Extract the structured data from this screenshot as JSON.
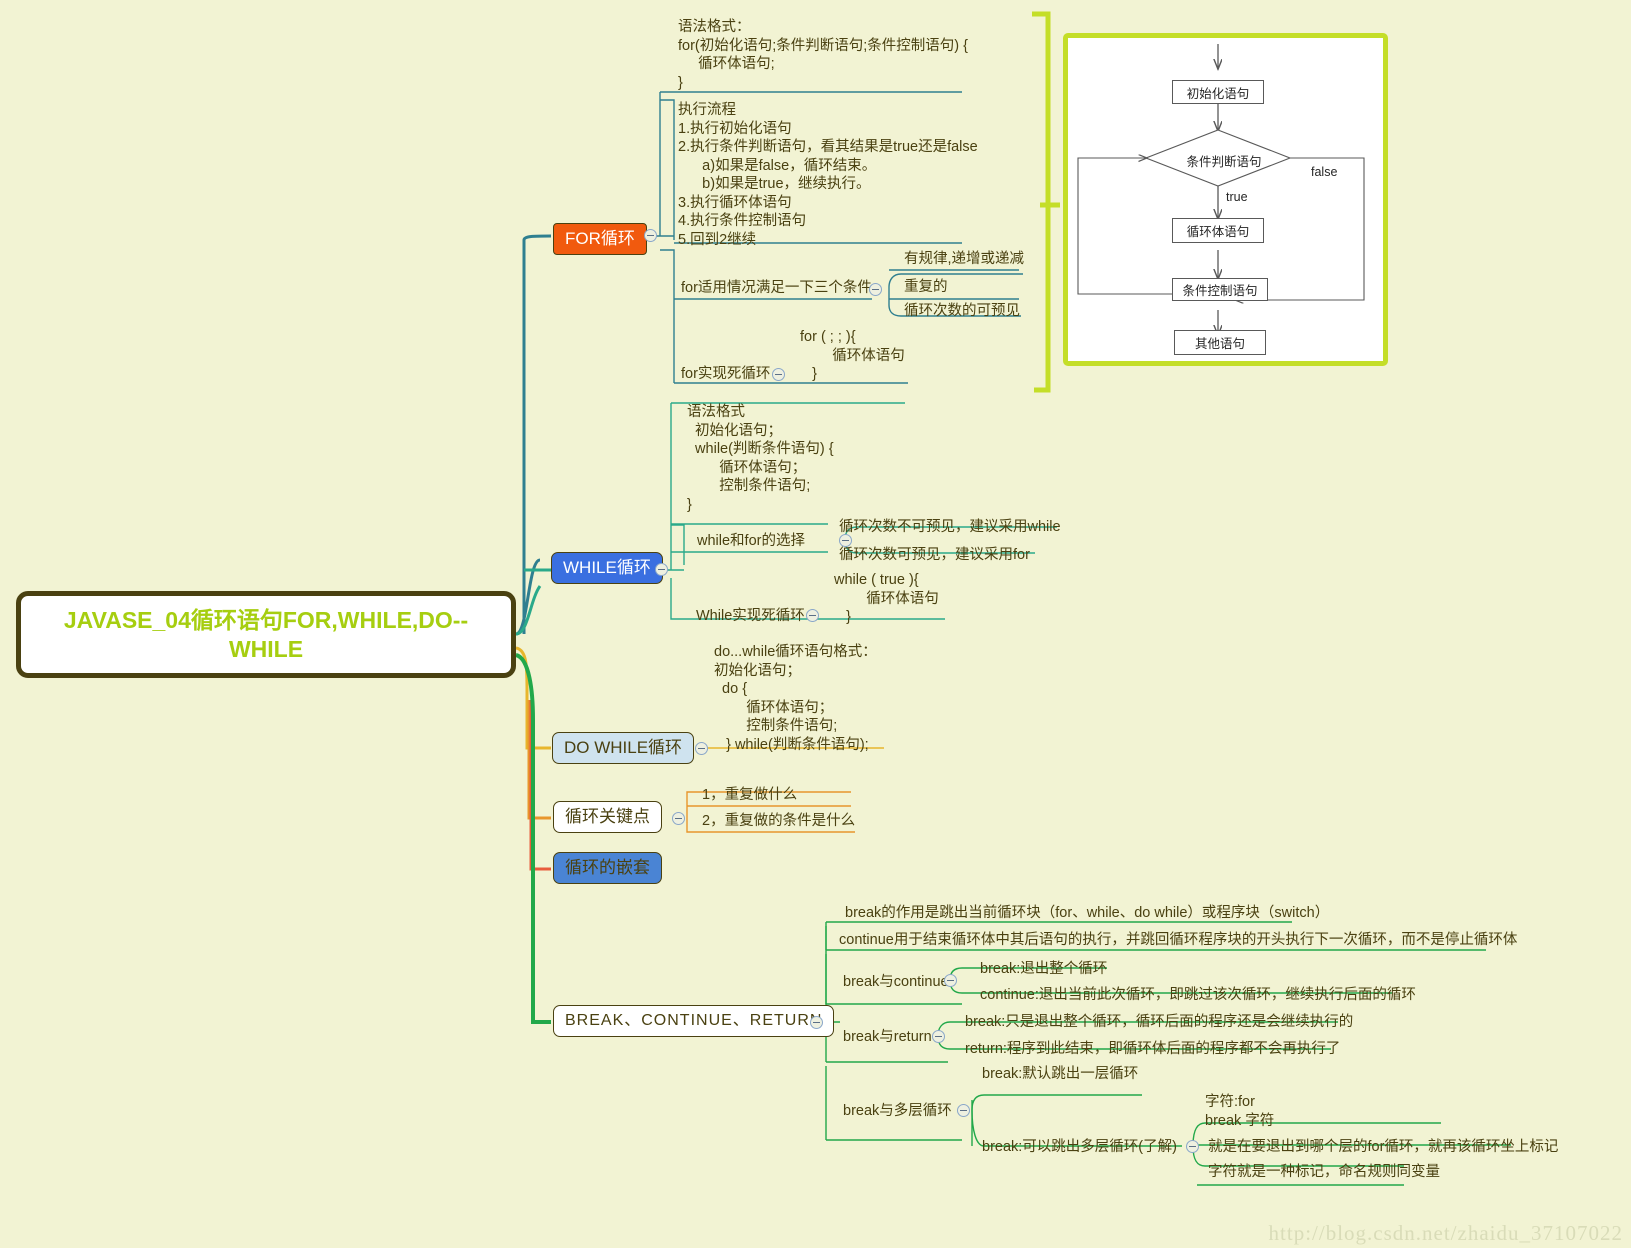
{
  "root": {
    "label": "JAVASE_04循环语句FOR,WHILE,DO--WHILE"
  },
  "topics": {
    "for": "FOR循环",
    "while": "WHILE循环",
    "dowhile": "DO WHILE循环",
    "keypoint": "循环关键点",
    "nest": "循环的嵌套",
    "bcr": "BREAK、CONTINUE、RETURN"
  },
  "for_branch": {
    "syntax": "语法格式：\nfor(初始化语句;条件判断语句;条件控制语句) {\n     循环体语句;\n}",
    "flow": "执行流程\n1.执行初始化语句\n2.执行条件判断语句，看其结果是true还是false\n      a)如果是false，循环结束。\n      b)如果是true，继续执行。\n3.执行循环体语句\n4.执行条件控制语句\n5.回到2继续",
    "conditions_label": "for适用情况满足一下三个条件",
    "conditions": [
      "有规律,递增或递减",
      "重复的",
      "循环次数的可预见"
    ],
    "dead_loop_label": "for实现死循环",
    "dead_loop_code": "for ( ; ; ){\n        循环体语句\n   }"
  },
  "flowchart": {
    "nodes": {
      "init": "初始化语句",
      "condition": "条件判断语句",
      "body": "循环体语句",
      "control": "条件控制语句",
      "other": "其他语句"
    },
    "labels": {
      "true": "true",
      "false": "false"
    }
  },
  "while_branch": {
    "syntax": "语法格式\n  初始化语句；\n  while(判断条件语句) {\n        循环体语句；\n        控制条件语句;\n}",
    "choice_label": "while和for的选择",
    "choices": [
      "循环次数不可预见，建议采用while",
      "循环次数可预见，建议采用for"
    ],
    "dead_loop_label": "While实现死循环",
    "dead_loop_code": "while ( true ){\n        循环体语句\n   }"
  },
  "dowhile_branch": {
    "syntax": "do...while循环语句格式：\n初始化语句；\n  do {\n        循环体语句；\n        控制条件语句;\n   } while(判断条件语句);"
  },
  "keypoint_branch": {
    "items": [
      "1，重复做什么",
      "2，重复做的条件是什么"
    ]
  },
  "bcr_branch": {
    "top_notes": [
      "break的作用是跳出当前循环块（for、while、do while）或程序块（switch）",
      "continue用于结束循环体中其后语句的执行，并跳回循环程序块的开头执行下一次循环，而不是停止循环体"
    ],
    "groups": [
      {
        "label": "break与continue",
        "items": [
          "break:退出整个循环",
          "continue:退出当前此次循环，即跳过该次循环，继续执行后面的循环"
        ]
      },
      {
        "label": "break与return",
        "items": [
          "break:只是退出整个循环，循环后面的程序还是会继续执行的",
          "return:程序到此结束，即循环体后面的程序都不会再执行了"
        ]
      },
      {
        "label": "break与多层循环",
        "items": [
          "break:默认跳出一层循环",
          "break:可以跳出多层循环(了解)"
        ],
        "detail_label": "break:可以跳出多层循环(了解)",
        "details_note": "字符:for\nbreak 字符",
        "details": [
          "就是在要退出到哪个层的for循环，就再该循环坐上标记",
          "字符就是一种标记，命名规则同变量"
        ]
      }
    ]
  },
  "watermark": "http://blog.csdn.net/zhaidu_37107022",
  "colors": {
    "background": "#f2f3d3",
    "root_border": "#4a4111",
    "root_text": "#a6ce10",
    "for_node": "#f15a0e",
    "while_node": "#3a6fe0",
    "dowhile_node": "#cfe3ef",
    "nest_node": "#4a84d4",
    "branch_for": "#2f7f90",
    "branch_while": "#2aa98a",
    "branch_dowhile": "#e8b62c",
    "branch_keypoint": "#e8962c",
    "branch_nest": "#e85c3c",
    "branch_bcr": "#22a84a",
    "flow_panel_border": "#c4de28"
  }
}
